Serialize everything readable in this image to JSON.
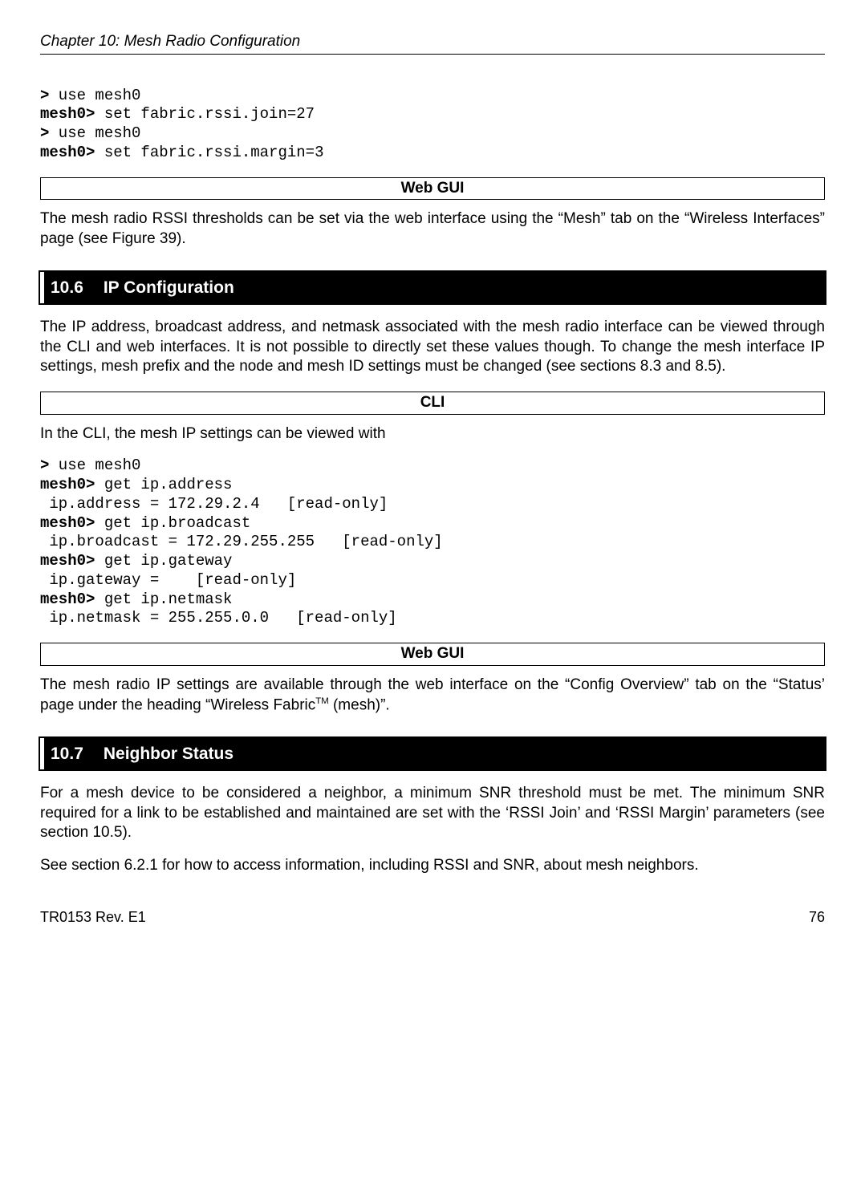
{
  "header": {
    "chapter_line": "Chapter 10: Mesh Radio Configuration"
  },
  "cli_block_1": {
    "l1_prompt": ">",
    "l1_cmd": " use mesh0",
    "l2_prompt": "mesh0>",
    "l2_cmd": " set fabric.rssi.join=27",
    "l3_prompt": ">",
    "l3_cmd": " use mesh0",
    "l4_prompt": "mesh0>",
    "l4_cmd": " set fabric.rssi.margin=3"
  },
  "webgui_label": "Web GUI",
  "cli_label": "CLI",
  "para_webgui_1": "The mesh radio RSSI thresholds can be set via the web interface using the “Mesh” tab on the “Wireless Interfaces” page (see Figure 39).",
  "section_10_6": {
    "num": "10.6",
    "title": "IP Configuration"
  },
  "para_10_6_intro": "The IP address, broadcast address, and netmask associated with the mesh radio interface can be viewed through the CLI and web interfaces. It is not possible to directly set these values though. To change the mesh interface IP settings, mesh prefix and the node and mesh ID settings must be changed (see sections 8.3 and 8.5).",
  "para_cli_10_6": "In the CLI, the mesh IP settings can be viewed with",
  "cli_block_2": {
    "l1_prompt": ">",
    "l1_cmd": " use mesh0",
    "l2_prompt": "mesh0>",
    "l2_cmd": " get ip.address",
    "l3": " ip.address = 172.29.2.4   [read-only]",
    "l4_prompt": "mesh0>",
    "l4_cmd": " get ip.broadcast",
    "l5": " ip.broadcast = 172.29.255.255   [read-only]",
    "l6_prompt": "mesh0>",
    "l6_cmd": " get ip.gateway",
    "l7": " ip.gateway =    [read-only]",
    "l8_prompt": "mesh0>",
    "l8_cmd": " get ip.netmask",
    "l9": " ip.netmask = 255.255.0.0   [read-only]"
  },
  "para_webgui_2_a": "The mesh radio IP settings are available through the web interface on the “Config Overview” tab on the “Status’ page under the heading “Wireless Fabric",
  "para_webgui_2_tm": "TM",
  "para_webgui_2_b": " (mesh)”.",
  "section_10_7": {
    "num": "10.7",
    "title": "Neighbor Status"
  },
  "para_10_7_a": "For a mesh device to be considered a neighbor, a minimum SNR  threshold must be met. The minimum SNR required for a link to be established and maintained are set with the ‘RSSI Join’ and ‘RSSI Margin’ parameters (see section 10.5).",
  "para_10_7_b": "See section 6.2.1 for how to access information, including RSSI and SNR, about mesh neighbors.",
  "footer": {
    "left": "TR0153 Rev. E1",
    "right": "76"
  }
}
